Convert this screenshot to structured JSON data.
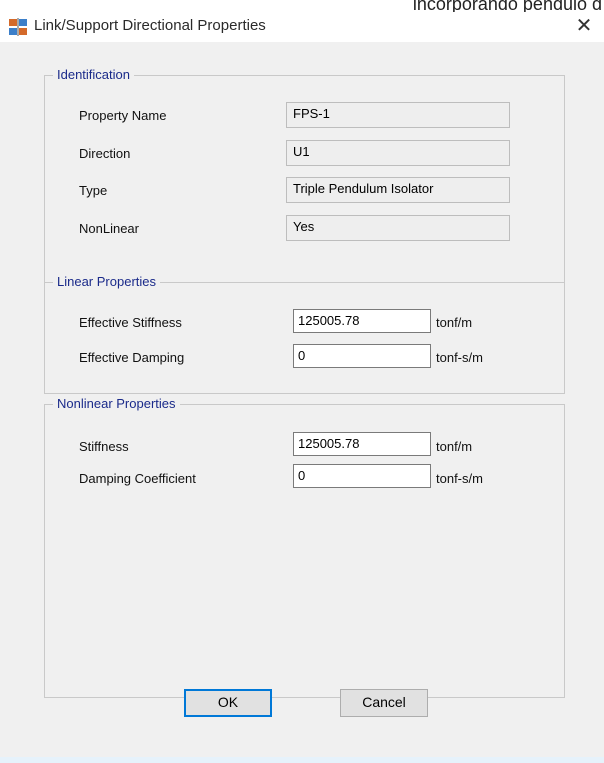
{
  "background": {
    "partial_text": "incorporando péndulo d"
  },
  "window": {
    "title": "Link/Support Directional Properties",
    "close_symbol": "✕"
  },
  "identification": {
    "legend": "Identification",
    "property_name_label": "Property Name",
    "property_name_value": "FPS-1",
    "direction_label": "Direction",
    "direction_value": "U1",
    "type_label": "Type",
    "type_value": "Triple Pendulum Isolator",
    "nonlinear_label": "NonLinear",
    "nonlinear_value": "Yes"
  },
  "linear": {
    "legend": "Linear Properties",
    "eff_stiffness_label": "Effective Stiffness",
    "eff_stiffness_value": "125005.78",
    "eff_stiffness_unit": "tonf/m",
    "eff_damping_label": "Effective Damping",
    "eff_damping_value": "0",
    "eff_damping_unit": "tonf-s/m"
  },
  "nonlinear": {
    "legend": "Nonlinear Properties",
    "stiffness_label": "Stiffness",
    "stiffness_value": "125005.78",
    "stiffness_unit": "tonf/m",
    "damping_coeff_label": "Damping Coefficient",
    "damping_coeff_value": "0",
    "damping_coeff_unit": "tonf-s/m"
  },
  "buttons": {
    "ok": "OK",
    "cancel": "Cancel"
  },
  "colors": {
    "group_label": "#1a2a8a",
    "focus_border": "#0078d7"
  },
  "icons": {
    "app": "app-grid-icon",
    "close": "close-icon"
  }
}
